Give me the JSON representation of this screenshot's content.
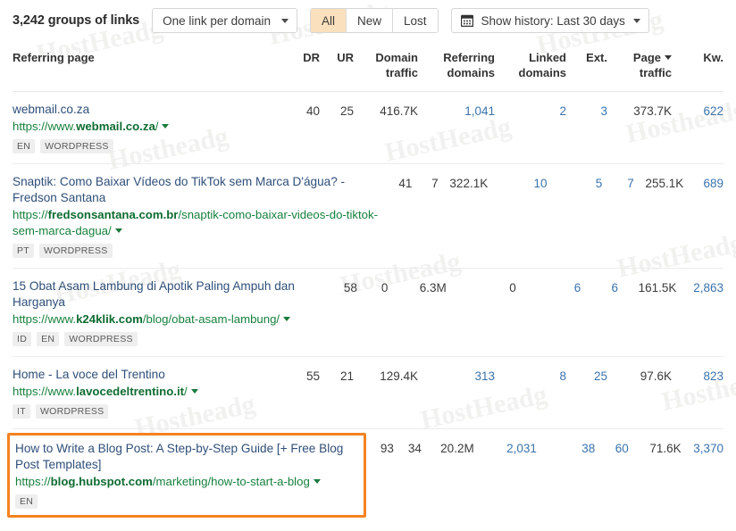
{
  "toolbar": {
    "groups_count": "3,242 groups of links",
    "link_mode": {
      "label": "One link per domain",
      "caret": "chevron-down-icon"
    },
    "filters": [
      {
        "label": "All",
        "active": true
      },
      {
        "label": "New",
        "active": false
      },
      {
        "label": "Lost",
        "active": false
      }
    ],
    "history": {
      "icon": "calendar-icon",
      "label": "Show history: Last 30 days",
      "caret": "chevron-down-icon"
    }
  },
  "table": {
    "headers": {
      "referring_page": "Referring page",
      "dr": "DR",
      "ur": "UR",
      "domain_traffic_l1": "Domain",
      "domain_traffic_l2": "traffic",
      "referring_domains_l1": "Referring",
      "referring_domains_l2": "domains",
      "linked_domains_l1": "Linked",
      "linked_domains_l2": "domains",
      "ext": "Ext.",
      "page_traffic_l1": "Page",
      "page_traffic_l2": "traffic",
      "kw": "Kw."
    },
    "sorted_column": "page_traffic",
    "rows": [
      {
        "title": "webmail.co.za",
        "url_prefix": "https://www.",
        "url_domain": "webmail.co.za",
        "url_suffix": "/",
        "badges": [
          "EN",
          "WORDPRESS"
        ],
        "dr": "40",
        "ur": "25",
        "domain_traffic": "416.7K",
        "referring_domains": "1,041",
        "referring_domains_link": true,
        "linked_domains": "2",
        "linked_domains_link": true,
        "ext": "3",
        "ext_link": true,
        "page_traffic": "373.7K",
        "kw": "622",
        "kw_link": true,
        "highlighted": false
      },
      {
        "title": "Snaptik: Como Baixar Vídeos do TikTok sem Marca D'água? - Fredson Santana",
        "url_prefix": "https://",
        "url_domain": "fredsonsantana.com.br",
        "url_suffix": "/snaptik-como-baixar-videos-do-tiktok-sem-marca-dagua/",
        "badges": [
          "PT",
          "WORDPRESS"
        ],
        "dr": "41",
        "ur": "7",
        "domain_traffic": "322.1K",
        "referring_domains": "10",
        "referring_domains_link": true,
        "linked_domains": "5",
        "linked_domains_link": true,
        "ext": "7",
        "ext_link": true,
        "page_traffic": "255.1K",
        "kw": "689",
        "kw_link": true,
        "highlighted": false
      },
      {
        "title": "15 Obat Asam Lambung di Apotik Paling Ampuh dan Harganya",
        "url_prefix": "https://www.",
        "url_domain": "k24klik.com",
        "url_suffix": "/blog/obat-asam-lambung/",
        "badges": [
          "ID",
          "EN",
          "WORDPRESS"
        ],
        "dr": "58",
        "ur": "0",
        "domain_traffic": "6.3M",
        "referring_domains": "0",
        "referring_domains_link": false,
        "linked_domains": "6",
        "linked_domains_link": true,
        "ext": "6",
        "ext_link": true,
        "page_traffic": "161.5K",
        "kw": "2,863",
        "kw_link": true,
        "highlighted": false
      },
      {
        "title": "Home - La voce del Trentino",
        "url_prefix": "https://www.",
        "url_domain": "lavocedeltrentino.it",
        "url_suffix": "/",
        "badges": [
          "IT",
          "WORDPRESS"
        ],
        "dr": "55",
        "ur": "21",
        "domain_traffic": "129.4K",
        "referring_domains": "313",
        "referring_domains_link": true,
        "linked_domains": "8",
        "linked_domains_link": true,
        "ext": "25",
        "ext_link": true,
        "page_traffic": "97.6K",
        "kw": "823",
        "kw_link": true,
        "highlighted": false
      },
      {
        "title": "How to Write a Blog Post: A Step-by-Step Guide [+ Free Blog Post Templates]",
        "url_prefix": "https://",
        "url_domain": "blog.hubspot.com",
        "url_suffix": "/marketing/how-to-start-a-blog",
        "badges": [
          "EN"
        ],
        "dr": "93",
        "ur": "34",
        "domain_traffic": "20.2M",
        "referring_domains": "2,031",
        "referring_domains_link": true,
        "linked_domains": "38",
        "linked_domains_link": true,
        "ext": "60",
        "ext_link": true,
        "page_traffic": "71.6K",
        "kw": "3,370",
        "kw_link": true,
        "highlighted": true
      }
    ]
  },
  "colors": {
    "accent_highlight": "#f58220",
    "active_filter_bg": "#fbe0bd",
    "link_blue": "#3a73ad",
    "url_green": "#17803d",
    "title_blue": "#2f4f79"
  },
  "watermarks": [
    "HostHeadg",
    "Hostheadg",
    "HostHeadg",
    "Hostheadg",
    "HostHeadg",
    "Hostheadg",
    "HostHeadg",
    "Hostheadg",
    "HostHeadg",
    "Hostheadg",
    "HostHeadg",
    "Hostheadg"
  ]
}
